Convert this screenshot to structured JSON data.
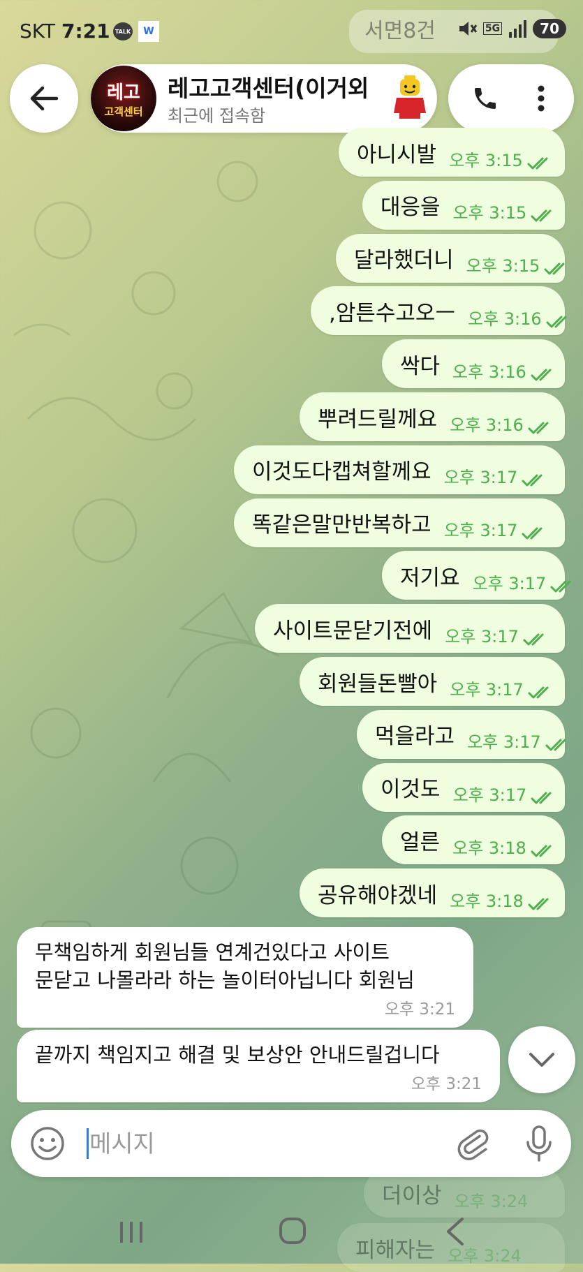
{
  "status_bar": {
    "carrier": "SKT",
    "time": "7:21",
    "talk_badge": "TALK",
    "app_badge": "W",
    "network": "5G",
    "battery": "70",
    "ghost_notification": "서면8건"
  },
  "header": {
    "title": "레고고객센터(이거외",
    "subtitle": "최근에 접속함",
    "avatar_line1": "레고",
    "avatar_line2": "고객센터"
  },
  "outgoing": [
    {
      "text": "아니시발",
      "time": "오후 3:15"
    },
    {
      "text": "대응을",
      "time": "오후 3:15"
    },
    {
      "text": "달라했더니",
      "time": "오후 3:15"
    },
    {
      "text": ",암튼수고오ㅡ",
      "time": "오후 3:16"
    },
    {
      "text": "싹다",
      "time": "오후 3:16"
    },
    {
      "text": "뿌려드릴께요",
      "time": "오후 3:16"
    },
    {
      "text": "이것도다캡쳐할께요",
      "time": "오후 3:17"
    },
    {
      "text": "똑같은말만반복하고",
      "time": "오후 3:17"
    },
    {
      "text": "저기요",
      "time": "오후 3:17"
    },
    {
      "text": "사이트문닫기전에",
      "time": "오후 3:17"
    },
    {
      "text": "회원들돈빨아",
      "time": "오후 3:17"
    },
    {
      "text": "먹을라고",
      "time": "오후 3:17"
    },
    {
      "text": "이것도",
      "time": "오후 3:17"
    },
    {
      "text": "얼른",
      "time": "오후 3:18"
    },
    {
      "text": "공유해야겠네",
      "time": "오후 3:18"
    }
  ],
  "incoming": [
    {
      "text": "무책임하게 회원님들 연계건있다고 사이트\n문닫고 나몰라라 하는 놀이터아닙니다 회원님",
      "time": "오후 3:21"
    },
    {
      "text": "끝까지 책임지고 해결 및 보상안 안내드릴겁니다",
      "time": "오후 3:21"
    }
  ],
  "behind_nav": [
    {
      "text": "더이상",
      "time": "오후 3:24"
    },
    {
      "text": "피해자는",
      "time": "오후 3:24"
    }
  ],
  "composer": {
    "placeholder": "메시지"
  },
  "colors": {
    "outgoing_bubble": "#eefedf",
    "outgoing_meta": "#4fae4e",
    "incoming_bubble": "#ffffff",
    "caret": "#3a7bd5"
  },
  "icons": {
    "back": "arrow-left-icon",
    "call": "phone-icon",
    "more": "more-vertical-icon",
    "emoji": "smiley-icon",
    "attach": "paperclip-icon",
    "mic": "microphone-icon",
    "scroll": "chevron-down-icon"
  }
}
